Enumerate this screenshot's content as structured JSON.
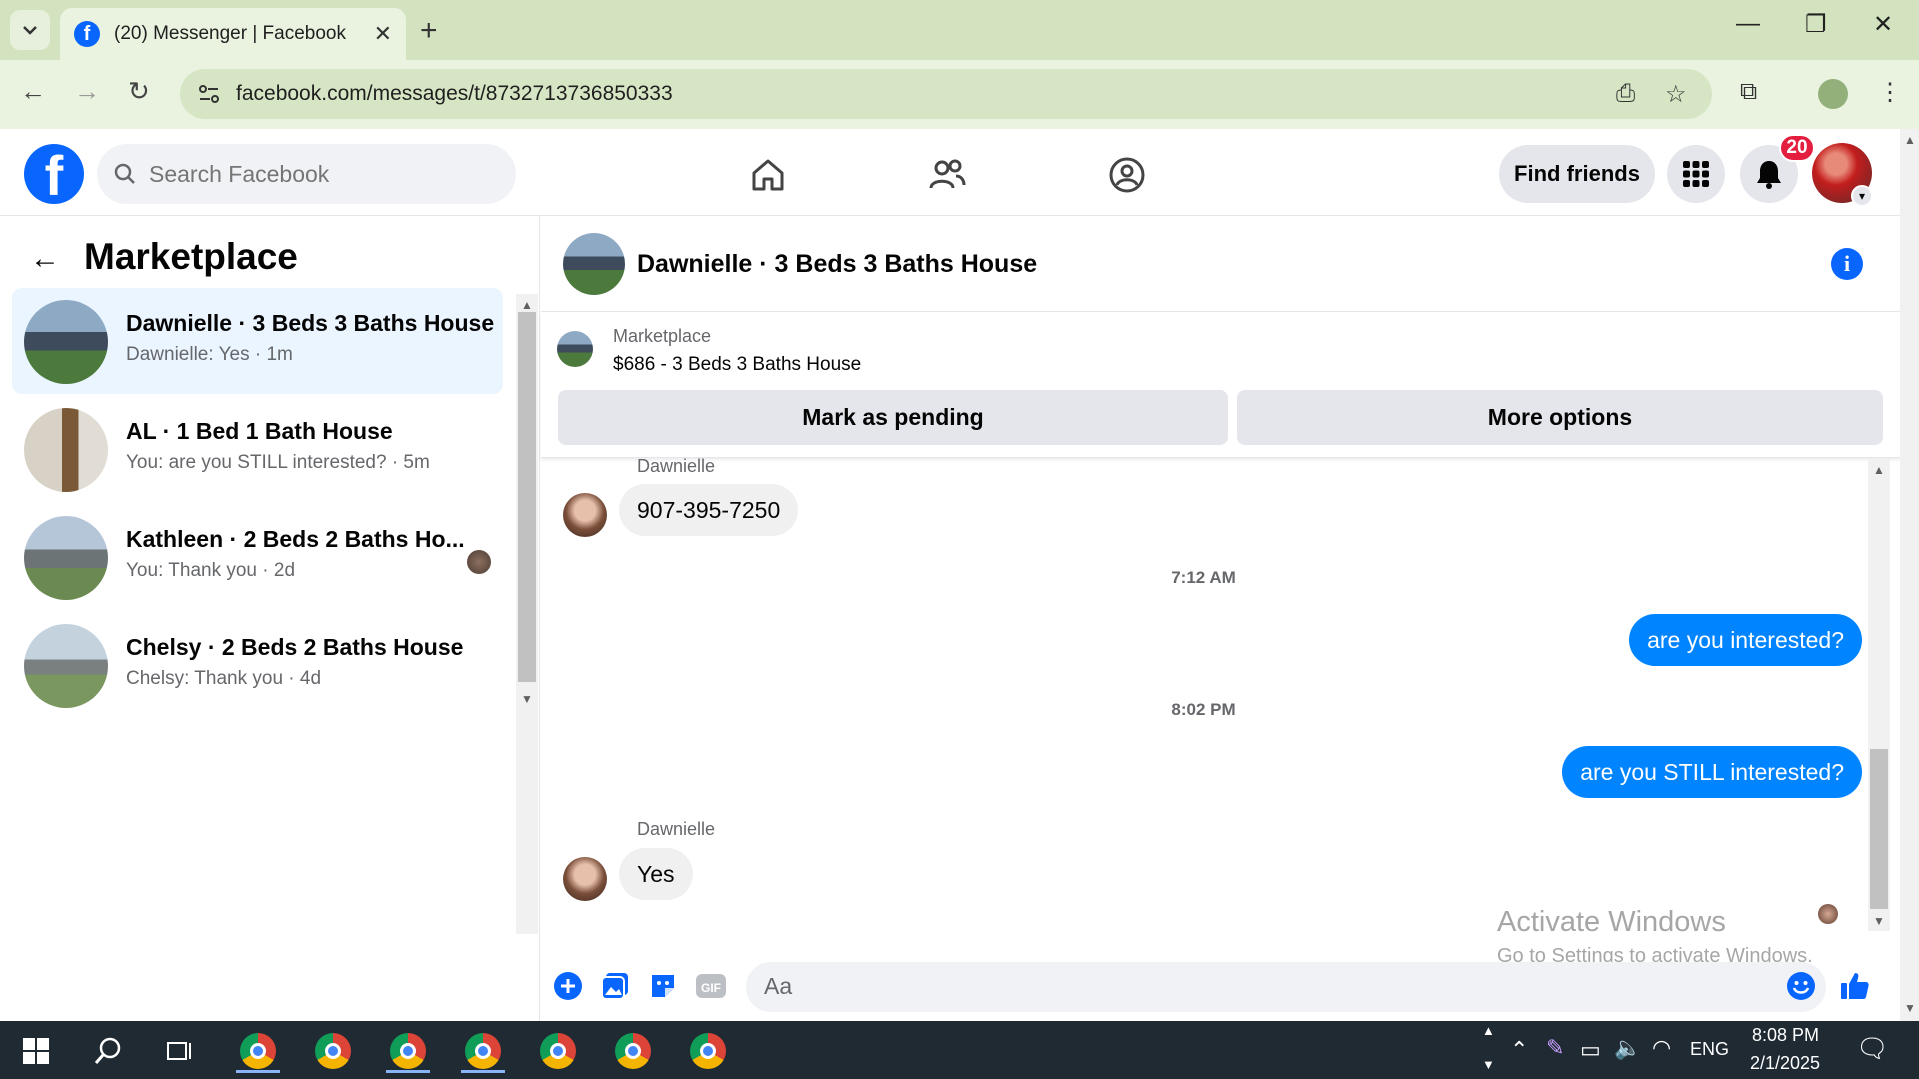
{
  "browser": {
    "tab_title": "(20) Messenger | Facebook",
    "url": "facebook.com/messages/t/8732713736850333"
  },
  "fb_header": {
    "search_placeholder": "Search Facebook",
    "find_friends": "Find friends",
    "notification_count": "20",
    "brand_color": "#0866ff"
  },
  "sidebar": {
    "title": "Marketplace",
    "conversations": [
      {
        "title": "Dawnielle · 3 Beds 3 Baths House",
        "subtitle": "Dawnielle: Yes · 1m",
        "active": true
      },
      {
        "title": "AL · 1 Bed 1 Bath House",
        "subtitle": "You: are you STILL interested? · 5m"
      },
      {
        "title": "Kathleen · 2 Beds 2 Baths Ho...",
        "subtitle": "You: Thank you · 2d"
      },
      {
        "title": "Chelsy · 2 Beds 2 Baths House",
        "subtitle": "Chelsy: Thank you · 4d"
      }
    ]
  },
  "chat": {
    "title": "Dawnielle · 3 Beds 3 Baths House",
    "listing": {
      "label": "Marketplace",
      "price_title": "$686 - 3 Beds 3 Baths House",
      "mark_pending": "Mark as pending",
      "more_options": "More options"
    },
    "messages": {
      "sender1": "Dawnielle",
      "msg1": "907-395-7250",
      "time1": "7:12 AM",
      "msg2": "are you interested?",
      "time2": "8:02 PM",
      "msg3": "are you STILL interested?",
      "sender2": "Dawnielle",
      "msg4": "Yes"
    },
    "composer_placeholder": "Aa",
    "outgoing_color": "#0084ff"
  },
  "watermark": {
    "line1": "Activate Windows",
    "line2": "Go to Settings to activate Windows."
  },
  "taskbar": {
    "language": "ENG",
    "time": "8:08 PM",
    "date": "2/1/2025"
  }
}
